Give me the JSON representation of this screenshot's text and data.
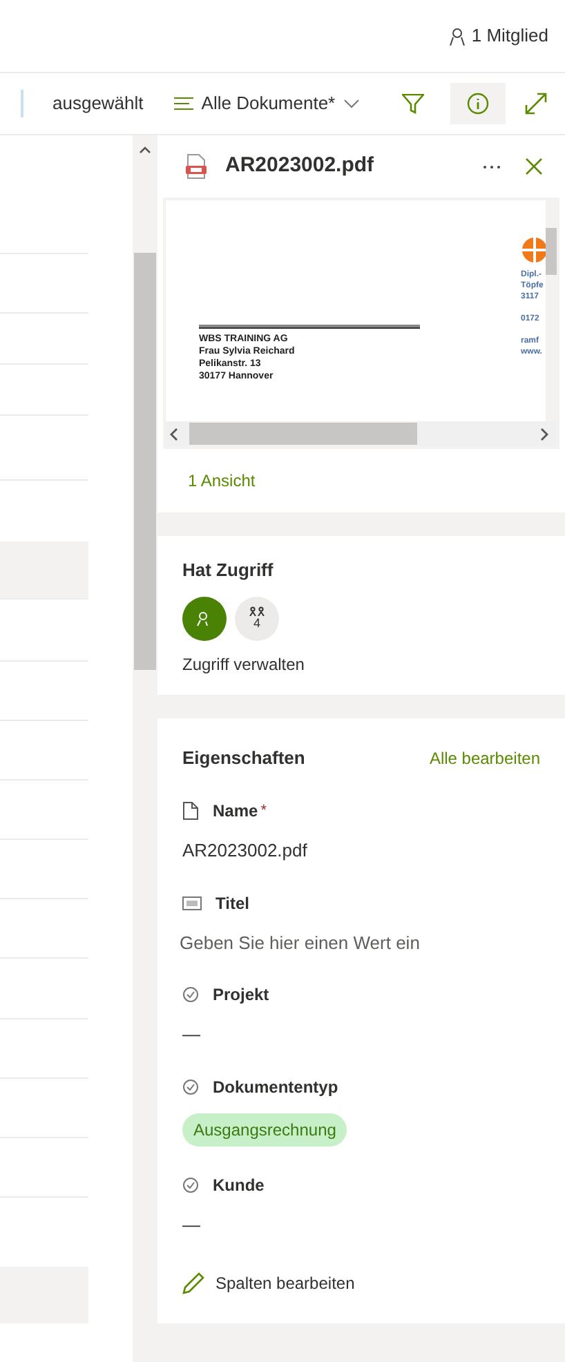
{
  "header": {
    "members": "1 Mitglied"
  },
  "toolbar": {
    "selection": "ausgewählt",
    "view": "Alle Dokumente*",
    "info_active": true
  },
  "panel": {
    "file_name": "AR2023002.pdf",
    "preview": {
      "address_lines": [
        "WBS TRAINING AG",
        "Frau Sylvia Reichard",
        "Pelikanstr. 13",
        "30177 Hannover"
      ],
      "side_groups": [
        [
          "Dipl.-",
          "Töpfe",
          "3117"
        ],
        [
          "0172"
        ],
        [
          "ramf",
          "www."
        ]
      ]
    },
    "views": "1 Ansicht",
    "access": {
      "title": "Hat Zugriff",
      "group_count": "4",
      "manage": "Zugriff verwalten"
    },
    "properties": {
      "title": "Eigenschaften",
      "edit_all": "Alle bearbeiten",
      "fields": [
        {
          "kind": "file",
          "label": "Name",
          "required_mark": "*",
          "value": "AR2023002.pdf"
        },
        {
          "kind": "text",
          "label": "Titel",
          "placeholder": "Geben Sie hier einen Wert ein"
        },
        {
          "kind": "choice",
          "label": "Projekt",
          "value": "—"
        },
        {
          "kind": "choice",
          "label": "Dokumententyp",
          "tag": "Ausgangsrechnung"
        },
        {
          "kind": "choice",
          "label": "Kunde",
          "value": "—"
        }
      ],
      "edit_columns": "Spalten bearbeiten"
    }
  }
}
